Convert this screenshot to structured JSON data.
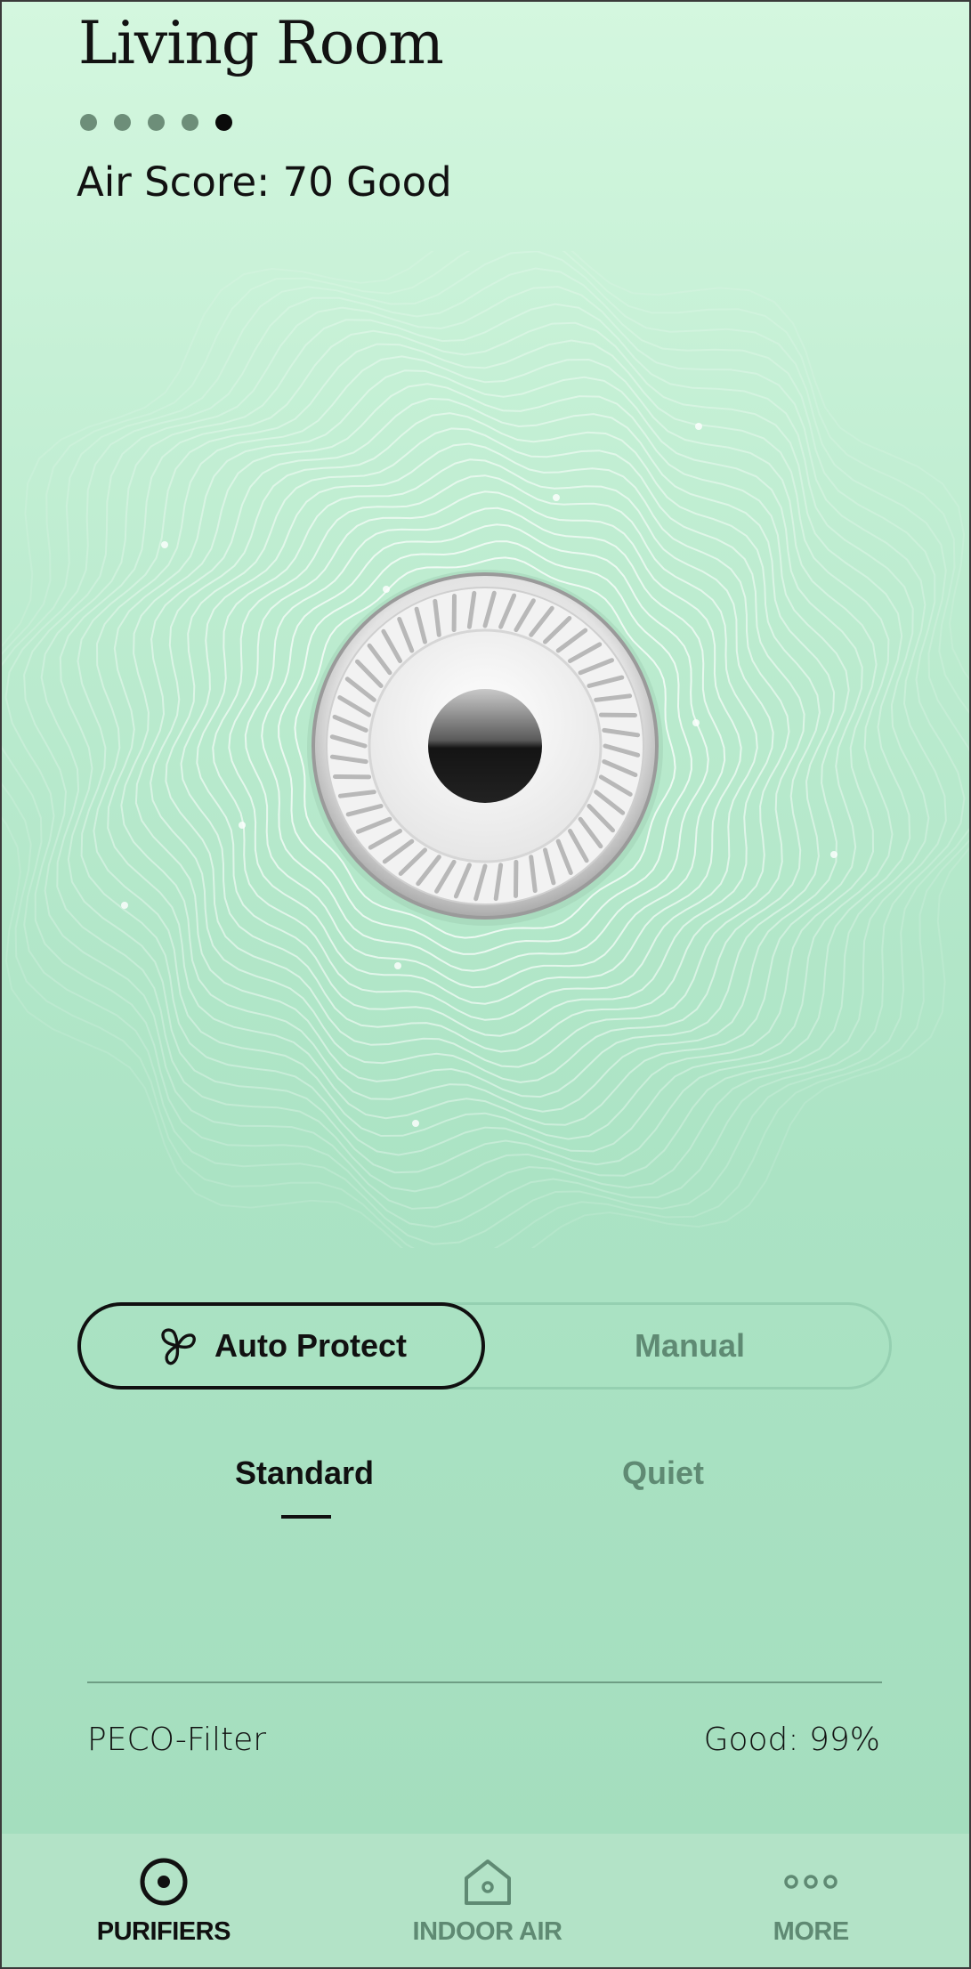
{
  "header": {
    "room_title": "Living Room",
    "page_count": 5,
    "active_page": 5,
    "air_score_label": "Air Score:",
    "air_score_value": "70 Good"
  },
  "modes": {
    "auto_label": "Auto Protect",
    "manual_label": "Manual",
    "selected": "auto"
  },
  "speed": {
    "standard_label": "Standard",
    "quiet_label": "Quiet",
    "selected": "standard"
  },
  "filter": {
    "label": "PECO-Filter",
    "status": "Good: 99%"
  },
  "nav": {
    "purifiers_label": "PURIFIERS",
    "indoor_air_label": "INDOOR AIR",
    "more_label": "MORE",
    "active": "purifiers"
  },
  "colors": {
    "background_top": "#d4f7df",
    "background_bottom": "#a3ddbd",
    "nav_background": "#b3e3c7",
    "active_text": "#101010",
    "inactive_text": "#5f8a73"
  }
}
